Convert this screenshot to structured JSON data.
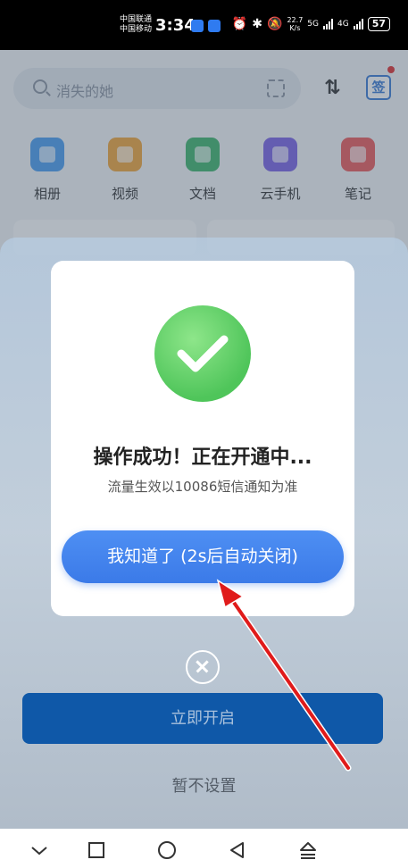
{
  "status_bar": {
    "carrier_1": "中国联通",
    "carrier_2": "中国移动",
    "time": "3:34",
    "net_speed_value": "22.7",
    "net_speed_unit": "K/s",
    "network_5g": "5G",
    "network_4g": "4G",
    "battery": "57"
  },
  "search": {
    "placeholder": "消失的她"
  },
  "header_icons": {
    "sign_in_label": "签"
  },
  "shortcuts": [
    {
      "label": "相册",
      "color": "#4a9ef0"
    },
    {
      "label": "视频",
      "color": "#f2a53a"
    },
    {
      "label": "文档",
      "color": "#3fb56c"
    },
    {
      "label": "云手机",
      "color": "#7b63e6"
    },
    {
      "label": "笔记",
      "color": "#ec5b5b"
    }
  ],
  "modal": {
    "title": "操作成功！正在开通中...",
    "subtitle": "流量生效以10086短信通知为准",
    "confirm_button": "我知道了 (2s后自动关闭)"
  },
  "sheet": {
    "primary_button": "立即开启",
    "skip_link": "暂不设置"
  },
  "colors": {
    "accent": "#3b7ae8",
    "success": "#4fc55a",
    "annotation_arrow": "#e01b1b"
  }
}
